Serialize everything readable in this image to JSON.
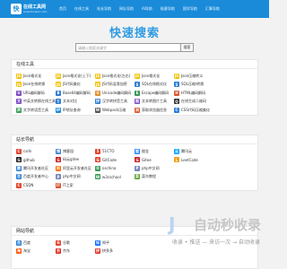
{
  "header": {
    "logo_mark": "快",
    "logo_title": "在线工具网",
    "logo_url": "www.toolson.com",
    "nav": [
      "首页",
      "在线工具",
      "站长导航",
      "网址导航",
      "AI导航",
      "极客导航",
      "国学导航",
      "汇算导航"
    ]
  },
  "brand_title": "快速搜索",
  "search": {
    "placeholder": "请输入搜索关键字",
    "button": "搜索"
  },
  "sections": [
    {
      "title": "在线工具",
      "items": [
        {
          "label": "Json格式化",
          "color": "#f2c200",
          "icon": "JS"
        },
        {
          "label": "Json格式化(上下)",
          "color": "#f2c200",
          "icon": "JS"
        },
        {
          "label": "Json格式化(左右)",
          "color": "#f2c200",
          "icon": "JS"
        },
        {
          "label": "Json格式化",
          "color": "#f2c200",
          "icon": "JS"
        },
        {
          "label": "Json压缩转义",
          "color": "#f2c200",
          "icon": "JS"
        },
        {
          "label": "",
          "color": "",
          "icon": ""
        },
        {
          "label": "Json在线转换",
          "color": "#f2c200",
          "icon": "JS"
        },
        {
          "label": "JS代码美化",
          "color": "#f2c200",
          "icon": "JS"
        },
        {
          "label": "JS代码混淆加密",
          "color": "#f2c200",
          "icon": "JS"
        },
        {
          "label": "SQL在线格式化",
          "color": "#2c7dd6",
          "icon": "S"
        },
        {
          "label": "SQL压缩/转换",
          "color": "#2c7dd6",
          "icon": "S"
        },
        {
          "label": "",
          "color": "",
          "icon": ""
        },
        {
          "label": "URL编码解码",
          "color": "#7a4bc2",
          "icon": "U"
        },
        {
          "label": "Base64编码解码",
          "color": "#2c7dd6",
          "icon": "B"
        },
        {
          "label": "Unicode编码解码",
          "color": "#e0902a",
          "icon": "U"
        },
        {
          "label": "Escape编码解码",
          "color": "#3a9a57",
          "icon": "E"
        },
        {
          "label": "HTML编码解码",
          "color": "#d9552e",
          "icon": "H"
        },
        {
          "label": "",
          "color": "",
          "icon": ""
        },
        {
          "label": "中英文转换在线工具",
          "color": "#7a4bc2",
          "icon": "文"
        },
        {
          "label": "文本对比",
          "color": "#2c7dd6",
          "icon": "T"
        },
        {
          "label": "汉字转拼音工具",
          "color": "#2c7dd6",
          "icon": "拼"
        },
        {
          "label": "文本转图片工具",
          "color": "#7a4bc2",
          "icon": "图"
        },
        {
          "label": "在线生成二维码",
          "color": "#333333",
          "icon": "Q"
        },
        {
          "label": "",
          "color": "",
          "icon": ""
        },
        {
          "label": "文字转语音工具",
          "color": "#3a9a57",
          "icon": "声"
        },
        {
          "label": "IP地址查询",
          "color": "#1a8bd9",
          "icon": "IP"
        },
        {
          "label": "Webpack压缩",
          "color": "#555555",
          "icon": "W"
        },
        {
          "label": "获取浏览器信息",
          "color": "#d9552e",
          "icon": "浏"
        },
        {
          "label": "CSS代码压缩美化",
          "color": "#2c7dd6",
          "icon": "C"
        },
        {
          "label": "",
          "color": "",
          "icon": ""
        }
      ]
    },
    {
      "title": "站长导航",
      "items": [
        {
          "label": "csdn",
          "color": "#e2462f",
          "icon": "C"
        },
        {
          "label": "博客园",
          "color": "#3a7fd0",
          "icon": "博"
        },
        {
          "label": "51CTO",
          "color": "#e2462f",
          "icon": "5"
        },
        {
          "label": "掘金",
          "color": "#1e80ff",
          "icon": "掘"
        },
        {
          "label": "腾讯云",
          "color": "#00a3ff",
          "icon": "云"
        },
        {
          "label": "",
          "color": "",
          "icon": ""
        },
        {
          "label": "github",
          "color": "#222222",
          "icon": "G"
        },
        {
          "label": "码云gitee",
          "color": "#c71d23",
          "icon": "G"
        },
        {
          "label": "GitCode",
          "color": "#e2462f",
          "icon": "G"
        },
        {
          "label": "Gitee",
          "color": "#c71d23",
          "icon": "G"
        },
        {
          "label": "LeetCode",
          "color": "#f0a020",
          "icon": "L"
        },
        {
          "label": "",
          "color": "",
          "icon": ""
        },
        {
          "label": "腾讯开发者社区",
          "color": "#2c7dd6",
          "icon": "腾"
        },
        {
          "label": "阿里云开发者社区",
          "color": "#ff6a00",
          "icon": "阿"
        },
        {
          "label": "oschina",
          "color": "#3a9a57",
          "icon": "O"
        },
        {
          "label": "php中文网",
          "color": "#7a86b8",
          "icon": "P"
        },
        {
          "label": "",
          "color": "",
          "icon": ""
        },
        {
          "label": "",
          "color": "",
          "icon": ""
        },
        {
          "label": "百度开发者中心",
          "color": "#2c7dd6",
          "icon": "百"
        },
        {
          "label": "php中文网",
          "color": "#7a86b8",
          "icon": "P"
        },
        {
          "label": "w3cschool",
          "color": "#3a9a57",
          "icon": "W"
        },
        {
          "label": "菜鸟教程",
          "color": "#5a9e2f",
          "icon": "菜"
        },
        {
          "label": "",
          "color": "",
          "icon": ""
        },
        {
          "label": "",
          "color": "",
          "icon": ""
        },
        {
          "label": "CSDN",
          "color": "#e2462f",
          "icon": "C"
        },
        {
          "label": "IT之家",
          "color": "#d9552e",
          "icon": "IT"
        },
        {
          "label": "",
          "color": "",
          "icon": ""
        },
        {
          "label": "",
          "color": "",
          "icon": ""
        },
        {
          "label": "",
          "color": "",
          "icon": ""
        },
        {
          "label": "",
          "color": "",
          "icon": ""
        }
      ]
    },
    {
      "title": "网站导航",
      "items": [
        {
          "label": "百度",
          "color": "#2c7dd6",
          "icon": "百"
        },
        {
          "label": "谷歌",
          "color": "#e2462f",
          "icon": "G"
        },
        {
          "label": "知乎",
          "color": "#0066ff",
          "icon": "知"
        },
        {
          "label": "",
          "color": "",
          "icon": ""
        },
        {
          "label": "",
          "color": "",
          "icon": ""
        },
        {
          "label": "",
          "color": "",
          "icon": ""
        },
        {
          "label": "淘宝",
          "color": "#ff5000",
          "icon": "淘"
        },
        {
          "label": "京东",
          "color": "#e2231a",
          "icon": "京"
        },
        {
          "label": "拼多多",
          "color": "#e02e24",
          "icon": "拼"
        },
        {
          "label": "",
          "color": "",
          "icon": ""
        },
        {
          "label": "",
          "color": "",
          "icon": ""
        },
        {
          "label": "",
          "color": "",
          "icon": ""
        }
      ]
    }
  ],
  "watermark": {
    "logo": "J",
    "text": "自动秒收录",
    "sub": "收录 • 推送 — 来访一次 → 自动收录"
  }
}
